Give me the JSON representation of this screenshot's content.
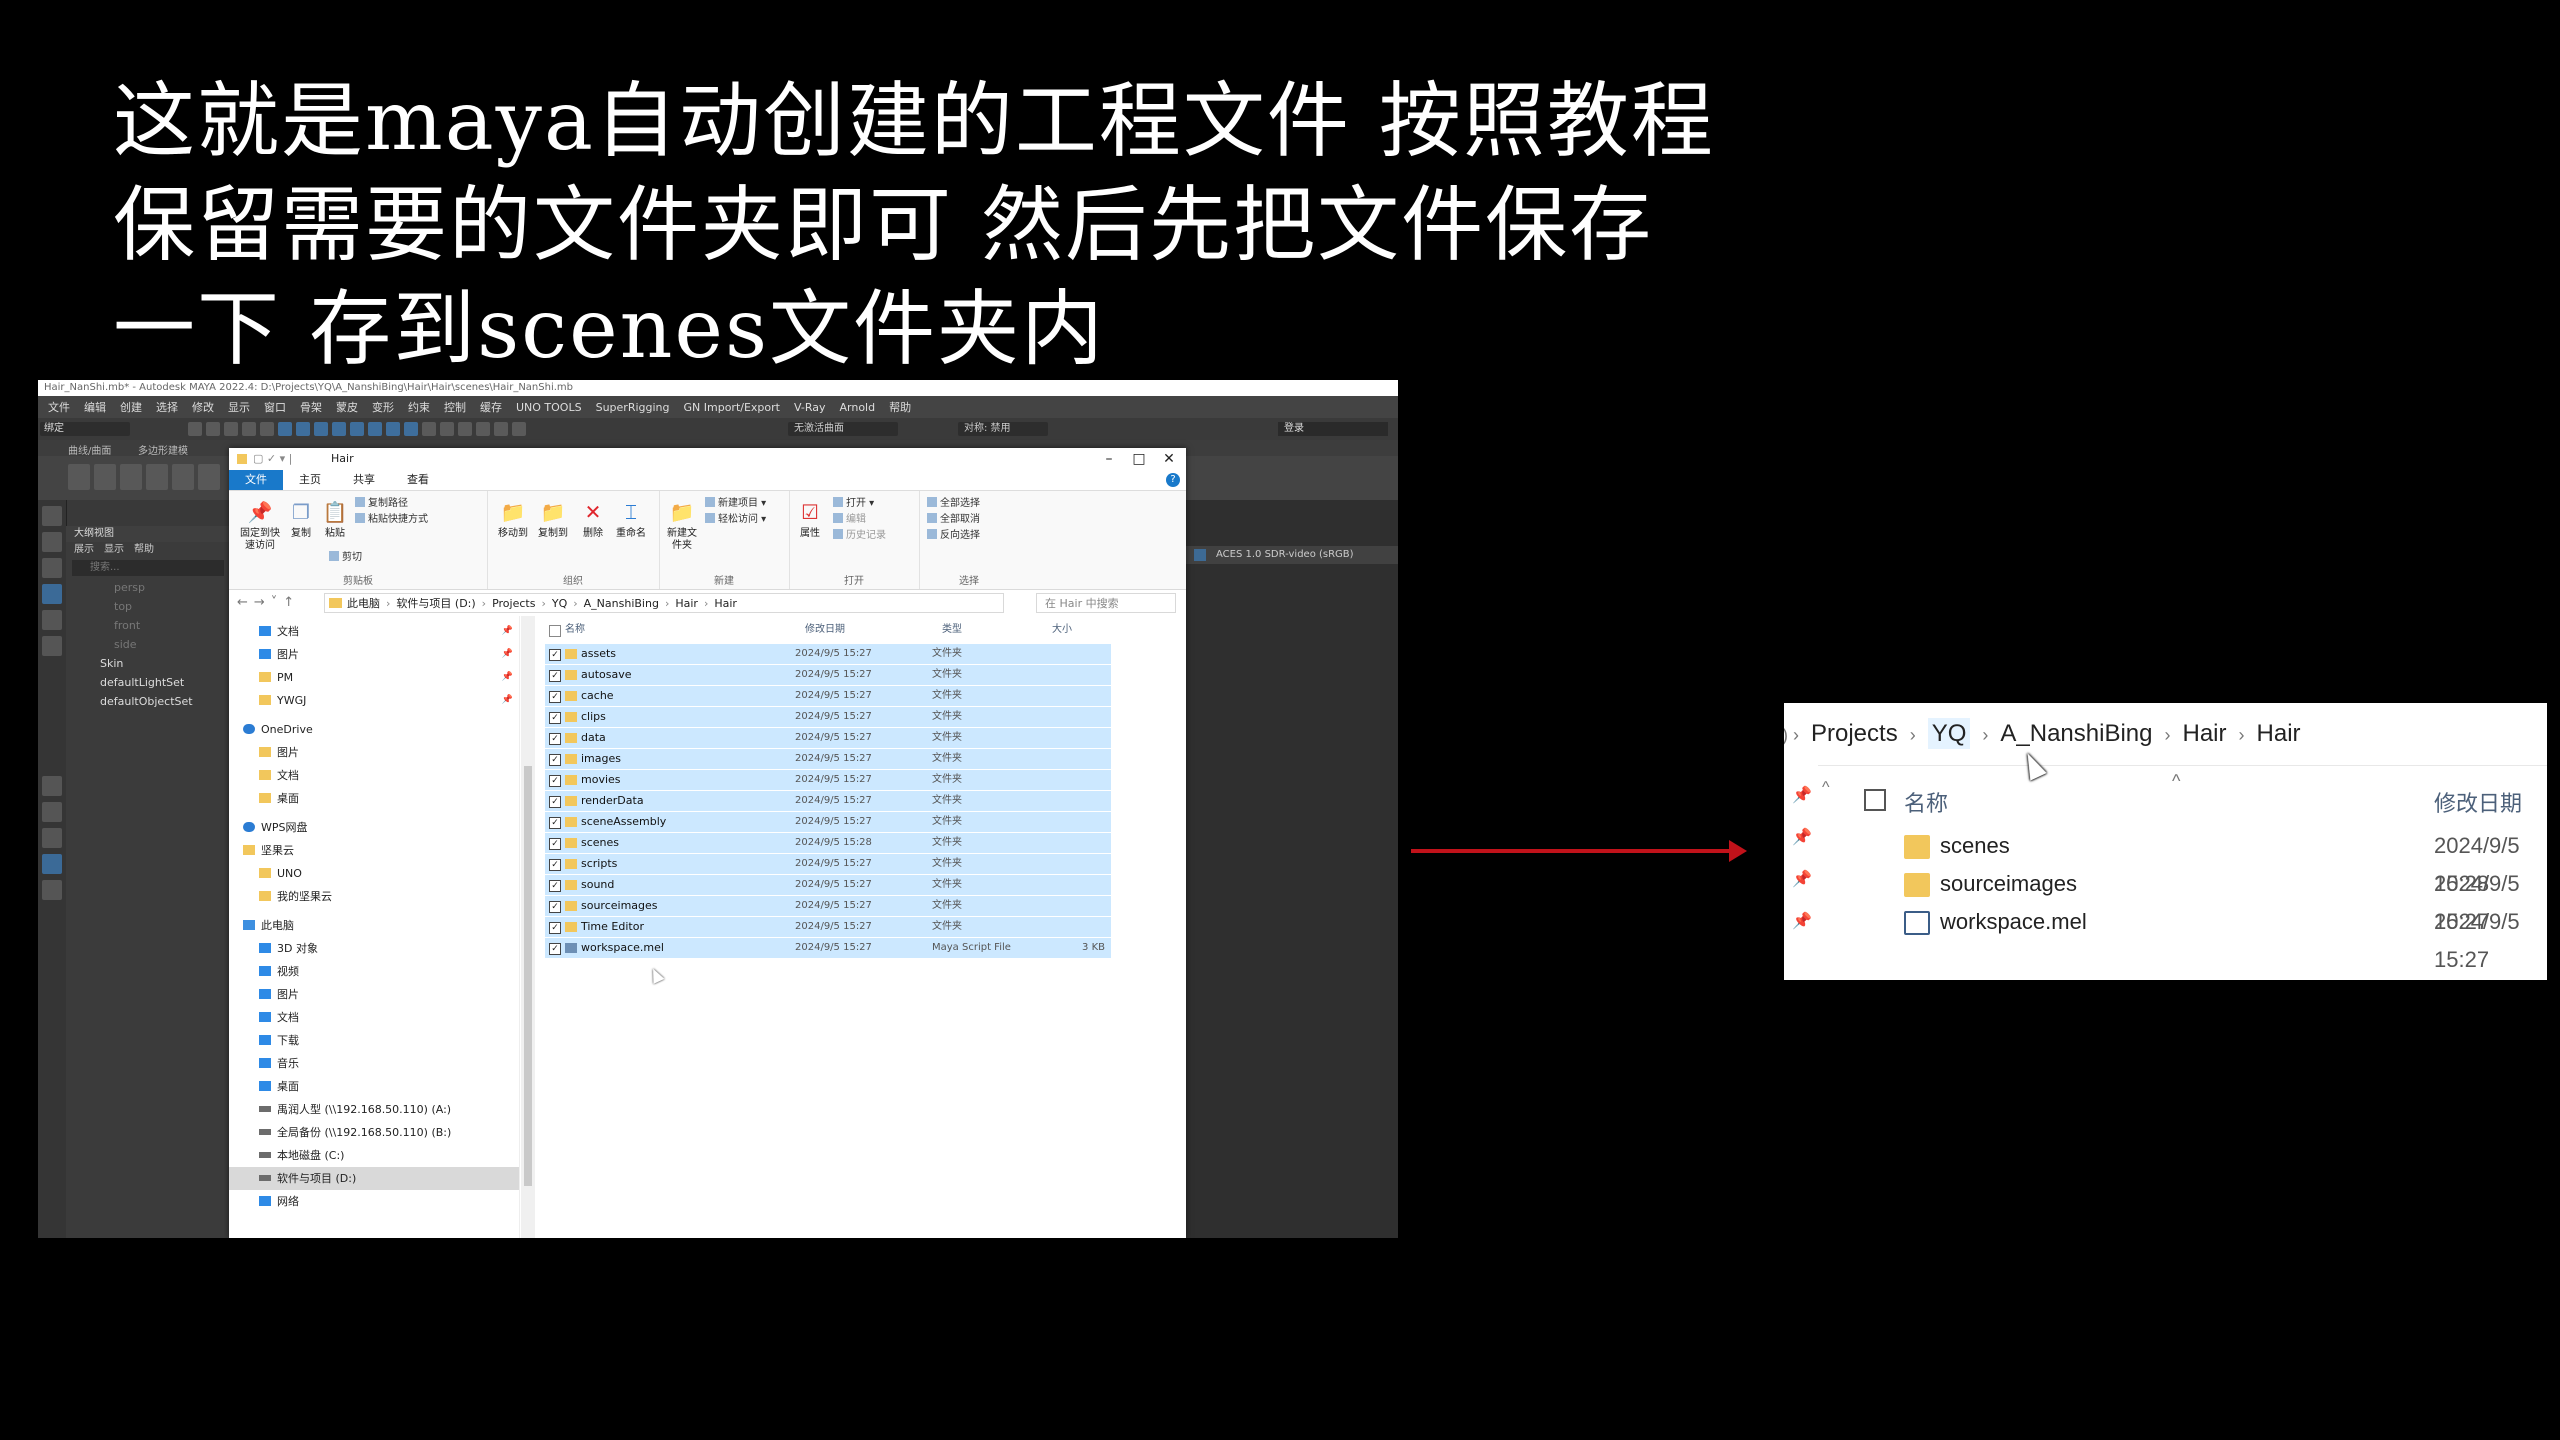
{
  "caption": {
    "line1": "这就是maya自动创建的工程文件 按照教程",
    "line2": "保留需要的文件夹即可 然后先把文件保存",
    "line3": "一下 存到scenes文件夹内"
  },
  "maya": {
    "title": "Hair_NanShi.mb* - Autodesk MAYA 2022.4: D:\\Projects\\YQ\\A_NanshiBing\\Hair\\Hair\\scenes\\Hair_NanShi.mb",
    "menu": [
      "文件",
      "编辑",
      "创建",
      "选择",
      "修改",
      "显示",
      "窗口",
      "骨架",
      "蒙皮",
      "变形",
      "约束",
      "控制",
      "缓存",
      "UNO TOOLS",
      "SuperRigging",
      "GN Import/Export",
      "V-Ray",
      "Arnold",
      "帮助"
    ],
    "status_mode": "绑定",
    "status_field": "无激活曲面",
    "status_obj": "对称: 禁用",
    "login": "登录",
    "shelf_tabs": [
      "曲线/曲面",
      "多边形建模"
    ],
    "outliner_title": "大纲视图",
    "outliner_menu": [
      "展示",
      "显示",
      "帮助"
    ],
    "outliner_search": "搜索...",
    "outliner_items": [
      {
        "label": "persp",
        "lit": false
      },
      {
        "label": "top",
        "lit": false
      },
      {
        "label": "front",
        "lit": false
      },
      {
        "label": "side",
        "lit": false
      },
      {
        "label": "Skin",
        "lit": true
      },
      {
        "label": "defaultLightSet",
        "lit": true
      },
      {
        "label": "defaultObjectSet",
        "lit": true
      }
    ],
    "viewport_label": "ACES 1.0 SDR-video (sRGB)"
  },
  "explorer": {
    "title": "Hair",
    "tabs": [
      "文件",
      "主页",
      "共享",
      "查看"
    ],
    "ribbon": {
      "pin_label": "固定到快速访问",
      "copy": "复制",
      "paste": "粘贴",
      "copy_path": "复制路径",
      "paste_shortcut": "粘贴快捷方式",
      "cut": "剪切",
      "clipboard": "剪贴板",
      "move_to": "移动到",
      "copy_to": "复制到",
      "delete": "删除",
      "rename": "重命名",
      "organize": "组织",
      "new_folder": "新建文件夹",
      "new_item": "新建项目",
      "easy_access": "轻松访问",
      "new": "新建",
      "properties": "属性",
      "open": "打开",
      "edit": "编辑",
      "history": "历史记录",
      "open_group": "打开",
      "select_all": "全部选择",
      "select_none": "全部取消",
      "invert": "反向选择",
      "select_group": "选择"
    },
    "address": [
      "此电脑",
      "软件与项目 (D:)",
      "Projects",
      "YQ",
      "A_NanshiBing",
      "Hair",
      "Hair"
    ],
    "search_placeholder": "在 Hair 中搜索",
    "nav": [
      {
        "label": "文档",
        "icon": "blue",
        "pin": true
      },
      {
        "label": "图片",
        "icon": "blue",
        "pin": true
      },
      {
        "label": "PM",
        "icon": "folder",
        "pin": true
      },
      {
        "label": "YWGJ",
        "icon": "folder",
        "pin": true
      },
      {
        "label": "OneDrive",
        "icon": "cloud",
        "pin": false
      },
      {
        "label": "图片",
        "icon": "folder",
        "pin": false
      },
      {
        "label": "文档",
        "icon": "folder",
        "pin": false
      },
      {
        "label": "桌面",
        "icon": "folder",
        "pin": false
      },
      {
        "label": "WPS网盘",
        "icon": "cloud",
        "pin": false
      },
      {
        "label": "坚果云",
        "icon": "folder",
        "pin": false
      },
      {
        "label": "UNO",
        "icon": "folder",
        "pin": false
      },
      {
        "label": "我的坚果云",
        "icon": "folder",
        "pin": false
      },
      {
        "label": "此电脑",
        "icon": "pc",
        "pin": false
      },
      {
        "label": "3D 对象",
        "icon": "blue",
        "pin": false
      },
      {
        "label": "视频",
        "icon": "blue",
        "pin": false
      },
      {
        "label": "图片",
        "icon": "blue",
        "pin": false
      },
      {
        "label": "文档",
        "icon": "blue",
        "pin": false
      },
      {
        "label": "下载",
        "icon": "blue",
        "pin": false
      },
      {
        "label": "音乐",
        "icon": "blue",
        "pin": false
      },
      {
        "label": "桌面",
        "icon": "blue",
        "pin": false
      },
      {
        "label": "禹润人型 (\\\\192.168.50.110) (A:)",
        "icon": "drive",
        "pin": false
      },
      {
        "label": "全局备份 (\\\\192.168.50.110) (B:)",
        "icon": "drive",
        "pin": false
      },
      {
        "label": "本地磁盘 (C:)",
        "icon": "drive",
        "pin": false
      },
      {
        "label": "软件与项目 (D:)",
        "icon": "drive",
        "pin": false,
        "selected": true
      },
      {
        "label": "网络",
        "icon": "blue",
        "pin": false
      }
    ],
    "columns": {
      "name": "名称",
      "date": "修改日期",
      "type": "类型",
      "size": "大小"
    },
    "files": [
      {
        "name": "assets",
        "date": "2024/9/5 15:27",
        "type": "文件夹",
        "size": ""
      },
      {
        "name": "autosave",
        "date": "2024/9/5 15:27",
        "type": "文件夹",
        "size": ""
      },
      {
        "name": "cache",
        "date": "2024/9/5 15:27",
        "type": "文件夹",
        "size": ""
      },
      {
        "name": "clips",
        "date": "2024/9/5 15:27",
        "type": "文件夹",
        "size": ""
      },
      {
        "name": "data",
        "date": "2024/9/5 15:27",
        "type": "文件夹",
        "size": ""
      },
      {
        "name": "images",
        "date": "2024/9/5 15:27",
        "type": "文件夹",
        "size": ""
      },
      {
        "name": "movies",
        "date": "2024/9/5 15:27",
        "type": "文件夹",
        "size": ""
      },
      {
        "name": "renderData",
        "date": "2024/9/5 15:27",
        "type": "文件夹",
        "size": ""
      },
      {
        "name": "sceneAssembly",
        "date": "2024/9/5 15:27",
        "type": "文件夹",
        "size": ""
      },
      {
        "name": "scenes",
        "date": "2024/9/5 15:28",
        "type": "文件夹",
        "size": ""
      },
      {
        "name": "scripts",
        "date": "2024/9/5 15:27",
        "type": "文件夹",
        "size": ""
      },
      {
        "name": "sound",
        "date": "2024/9/5 15:27",
        "type": "文件夹",
        "size": ""
      },
      {
        "name": "sourceimages",
        "date": "2024/9/5 15:27",
        "type": "文件夹",
        "size": ""
      },
      {
        "name": "Time Editor",
        "date": "2024/9/5 15:27",
        "type": "文件夹",
        "size": ""
      },
      {
        "name": "workspace.mel",
        "date": "2024/9/5 15:27",
        "type": "Maya Script File",
        "size": "3 KB",
        "mel": true
      }
    ]
  },
  "zoom": {
    "address": [
      "Projects",
      "YQ",
      "A_NanshiBing",
      "Hair",
      "Hair"
    ],
    "col_name": "名称",
    "col_date": "修改日期",
    "files": [
      {
        "name": "scenes",
        "date": "2024/9/5 15:28",
        "mel": false
      },
      {
        "name": "sourceimages",
        "date": "2024/9/5 15:27",
        "mel": false
      },
      {
        "name": "workspace.mel",
        "date": "2024/9/5 15:27",
        "mel": true
      }
    ]
  },
  "colors": {
    "accent": "#1979ca",
    "selection": "#cce8ff",
    "arrow": "#c1121a",
    "folder": "#f2c75c"
  }
}
